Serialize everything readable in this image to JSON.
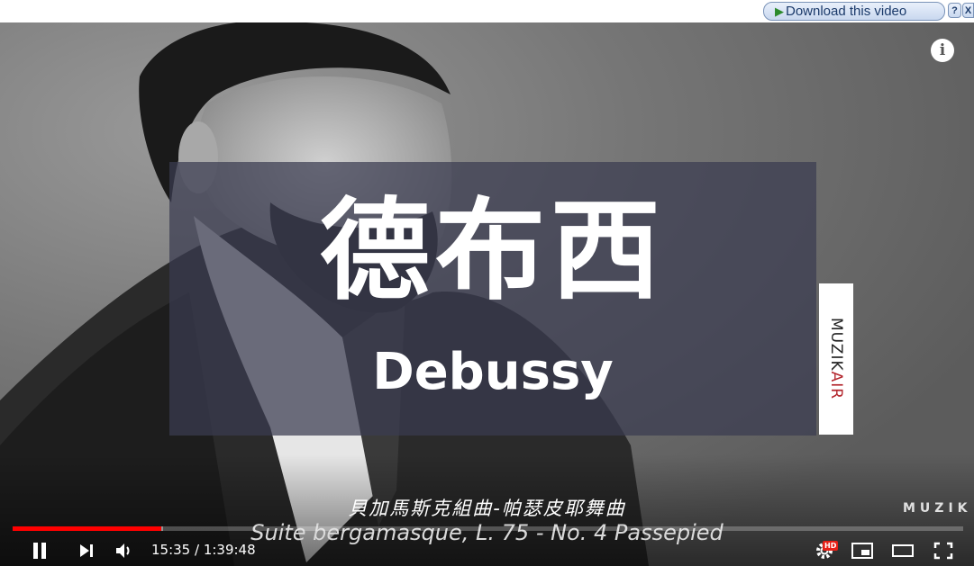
{
  "topbar": {
    "download_label": "Download this video",
    "help_label": "?",
    "close_label": "X"
  },
  "video": {
    "title_cn": "德布西",
    "title_en": "Debussy",
    "side_tab_main": "MUZIK",
    "side_tab_accent": "AIR",
    "watermark": "MUZIK",
    "info_label": "i",
    "caption_cn": "貝加馬斯克組曲-帕瑟皮耶舞曲",
    "caption_en": "Suite bergamasque, L. 75 - No. 4 Passepied"
  },
  "player": {
    "current_time": "15:35",
    "duration": "1:39:48",
    "time_display": "15:35 / 1:39:48",
    "progress_played_fraction": 0.156,
    "progress_loaded_fraction": 0.158,
    "hd_badge": "HD",
    "accent_color": "#ff0000"
  },
  "icons": [
    "pause-icon",
    "next-icon",
    "volume-icon",
    "settings-icon",
    "miniplayer-icon",
    "theater-icon",
    "fullscreen-icon",
    "info-icon",
    "play-icon"
  ]
}
